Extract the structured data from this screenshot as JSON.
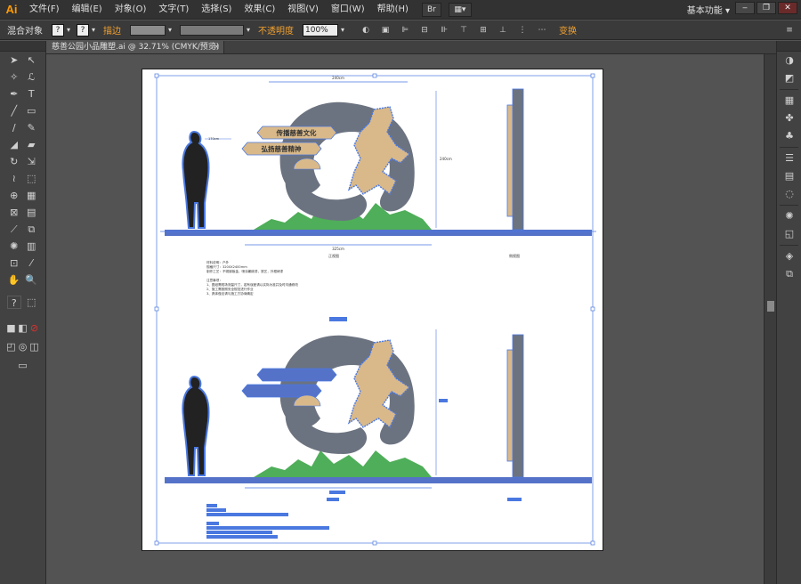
{
  "app": {
    "logo": "Ai",
    "workspace": "基本功能"
  },
  "menu": [
    "文件(F)",
    "编辑(E)",
    "对象(O)",
    "文字(T)",
    "选择(S)",
    "效果(C)",
    "视图(V)",
    "窗口(W)",
    "帮助(H)"
  ],
  "menu_buttons": [
    "Br",
    "▦▾"
  ],
  "window_controls": [
    "‒",
    "❐",
    "✕"
  ],
  "control": {
    "object_type": "混合对象",
    "stroke_label": "描边",
    "opacity_label": "不透明度",
    "opacity_value": "100%",
    "transform_label": "变换"
  },
  "document_tab": {
    "title": "慈善公园小品雕塑.ai @ 32.71% (CMYK/预览)",
    "close": "×"
  },
  "artwork": {
    "banner_top": "传播慈善文化",
    "banner_bottom": "弘扬慈善精神",
    "label_front": "正视图",
    "label_side": "侧视图",
    "dim_width": "325cm",
    "dim_height": "240cm",
    "dim_top": "240cm",
    "person_note": "170cm",
    "notes": [
      "材料说明：户外",
      "规格尺寸：3200X2400mm",
      "制作工艺：不锈钢钣金，喷涂氟碳漆，铁艺，外框烤漆",
      "",
      "注意事项：",
      "1、图纸需现场测量尺寸，若有误差请以实际为准并及时沟通修改",
      "2、施工需按照安全规范进行作业",
      "3、具体做法请与施工方协商确定"
    ]
  },
  "colors": {
    "steel": "#6c7380",
    "sand": "#d9b98a",
    "grass": "#4fae59",
    "select": "#4a78e0",
    "base": "#5572c9"
  }
}
